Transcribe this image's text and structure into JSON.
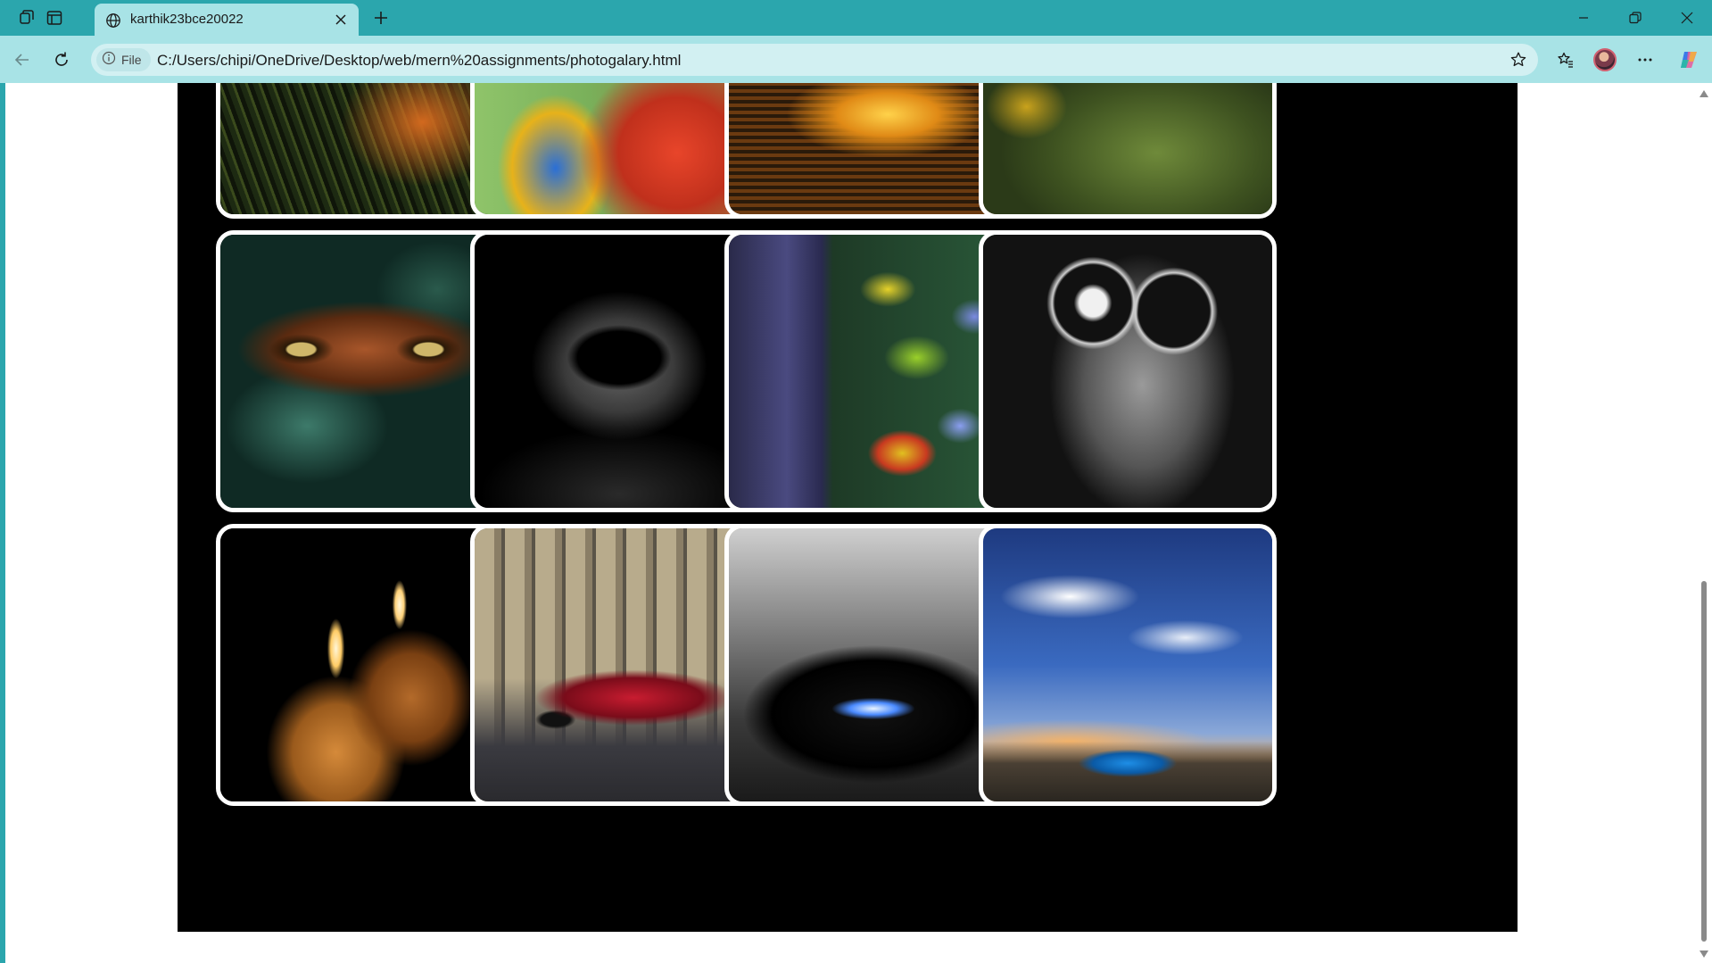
{
  "browser": {
    "tab": {
      "title": "karthik23bce20022"
    },
    "address_bar": {
      "scheme_label": "File",
      "url": "C:/Users/chipi/OneDrive/Desktop/web/mern%20assignments/photogalary.html"
    },
    "colors": {
      "frame": "#2ba6ad",
      "toolbar": "#a8e3e6",
      "omnibox": "#d2f0f2"
    }
  },
  "gallery": {
    "background": "#000000",
    "photo_border": "#ffffff",
    "photos": [
      {
        "subject": "jungle foliage",
        "name": "photo-jungle"
      },
      {
        "subject": "macaw parrot",
        "name": "photo-parrot"
      },
      {
        "subject": "sunset over water",
        "name": "photo-sunset-water"
      },
      {
        "subject": "sunflower field",
        "name": "photo-sunflower"
      },
      {
        "subject": "tiger in leaves",
        "name": "photo-tiger"
      },
      {
        "subject": "hooded figure",
        "name": "photo-hooded-figure"
      },
      {
        "subject": "tree with autumn leaves",
        "name": "photo-autumn-leaves"
      },
      {
        "subject": "cat with sunglasses",
        "name": "photo-cat-sunglasses"
      },
      {
        "subject": "two candles",
        "name": "photo-candles"
      },
      {
        "subject": "red sports car",
        "name": "photo-red-car"
      },
      {
        "subject": "black car headlights",
        "name": "photo-black-car"
      },
      {
        "subject": "blue car under sky",
        "name": "photo-blue-car"
      }
    ]
  },
  "scrollbar": {
    "position_fraction": 0.57
  }
}
